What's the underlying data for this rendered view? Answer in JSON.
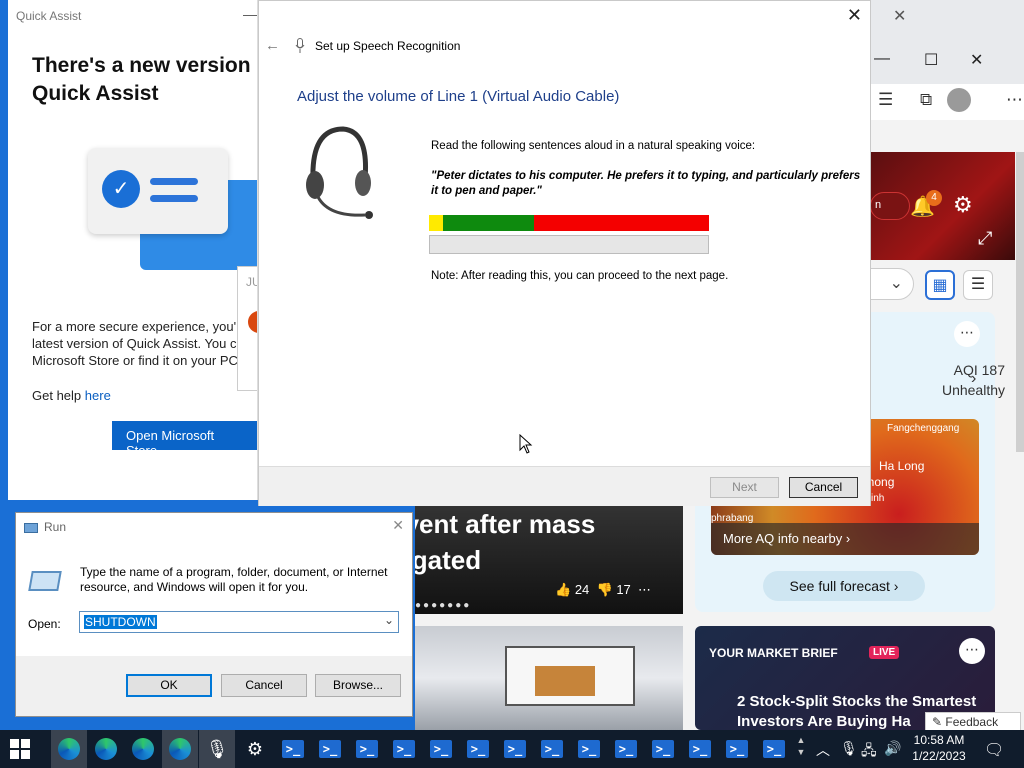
{
  "edge": {
    "tab_close": "✕",
    "win_controls": [
      "—",
      "☐",
      "✕"
    ],
    "toolbar_icons": [
      "☰",
      "⧉",
      "⋯"
    ],
    "hero": {
      "pill_text": "n",
      "notification_count": "4"
    },
    "weather": {
      "aqi_value": "AQI 187",
      "aqi_status": "Unhealthy",
      "map_labels": [
        "Fangchenggang",
        "Ha Long",
        "phong",
        "inh",
        "phrabang"
      ],
      "more_aq_label": "More AQ info nearby",
      "forecast_button": "See full forecast"
    },
    "news": {
      "headline": "o event after mass\nestigated",
      "likes": "24",
      "dislikes": "17"
    },
    "market": {
      "kicker": "YOUR MARKET BRIEF",
      "live": "LIVE",
      "title": "2 Stock-Split Stocks the Smartest Investors Are Buying Ha"
    },
    "feedback_label": "Feedback"
  },
  "quick_assist": {
    "title": "Quick Assist",
    "heading": "There's a new version Quick Assist",
    "body": "For a more secure experience, you'll\nlatest version of Quick Assist. You ca\nMicrosoft Store or find it on your PC",
    "get_help_prefix": "Get help",
    "get_help_link": "here",
    "store_button": "Open Microsoft Store",
    "peek_text": "JU"
  },
  "speech_wizard": {
    "window_title": "Set up Speech Recognition",
    "heading": "Adjust the volume of Line 1 (Virtual Audio Cable)",
    "instruction": "Read the following sentences aloud in a natural speaking voice:",
    "quote": "\"Peter dictates to his computer. He prefers it to typing, and particularly prefers it to pen and paper.\"",
    "note": "Note: After reading this, you can proceed to the next page.",
    "progress": 0,
    "next_label": "Next",
    "cancel_label": "Cancel"
  },
  "run_dialog": {
    "title": "Run",
    "description": "Type the name of a program, folder, document, or Internet resource, and Windows will open it for you.",
    "open_label": "Open:",
    "open_value": "SHUTDOWN",
    "ok_label": "OK",
    "cancel_label": "Cancel",
    "browse_label": "Browse..."
  },
  "taskbar": {
    "time": "10:58 AM",
    "date": "1/22/2023"
  }
}
